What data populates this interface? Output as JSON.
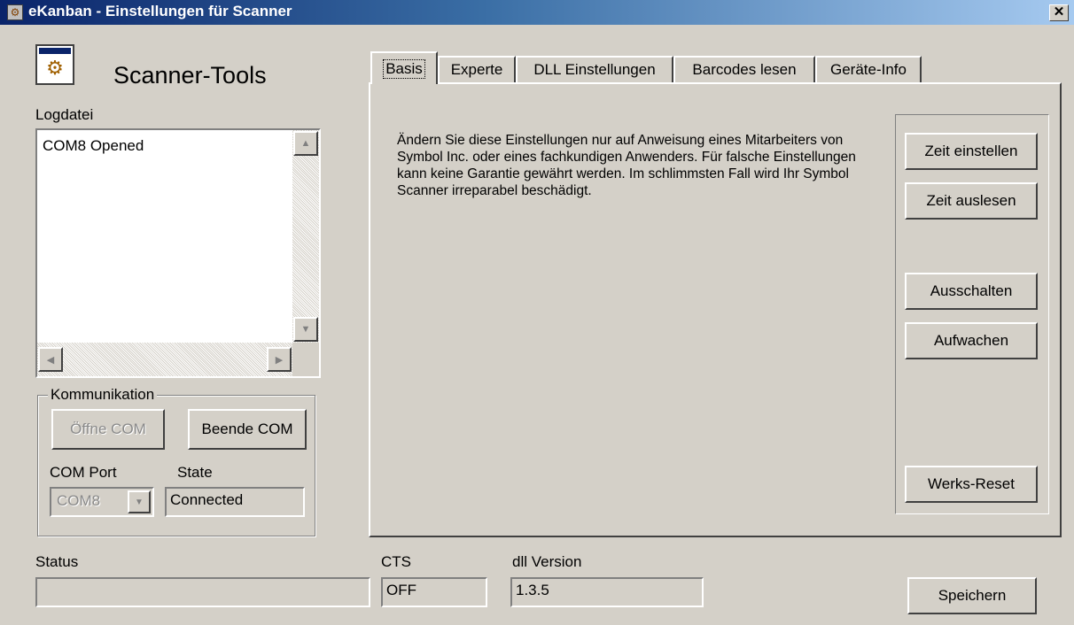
{
  "window": {
    "title": "eKanban - Einstellungen für Scanner",
    "close_glyph": "✕",
    "app_icon": "gear-icon"
  },
  "header": {
    "app_title": "Scanner-Tools",
    "logo_icon": "settings-gear-icon"
  },
  "log": {
    "label": "Logdatei",
    "lines": [
      "COM8 Opened"
    ]
  },
  "communication": {
    "group_label": "Kommunikation",
    "open_button": "Öffne COM",
    "close_button": "Beende COM",
    "com_port_label": "COM Port",
    "com_port_value": "COM8",
    "state_label": "State",
    "state_value": "Connected"
  },
  "tabs": [
    {
      "label": "Basis",
      "active": true
    },
    {
      "label": "Experte",
      "active": false
    },
    {
      "label": "DLL Einstellungen",
      "active": false
    },
    {
      "label": "Barcodes lesen",
      "active": false
    },
    {
      "label": "Geräte-Info",
      "active": false
    }
  ],
  "basis": {
    "warning": "Ändern Sie diese Einstellungen nur auf Anweisung eines Mitarbeiters von Symbol Inc. oder eines fachkundigen Anwenders. Für falsche Einstellungen kann keine Garantie gewährt werden. Im schlimmsten Fall wird Ihr Symbol Scanner irreparabel beschädigt.",
    "buttons": {
      "set_time": "Zeit einstellen",
      "read_time": "Zeit auslesen",
      "power_off": "Ausschalten",
      "wake_up": "Aufwachen",
      "factory_reset": "Werks-Reset"
    }
  },
  "statusbar": {
    "status_label": "Status",
    "status_value": "",
    "cts_label": "CTS",
    "cts_value": "OFF",
    "dll_label": "dll Version",
    "dll_value": "1.3.5",
    "save_button": "Speichern"
  }
}
